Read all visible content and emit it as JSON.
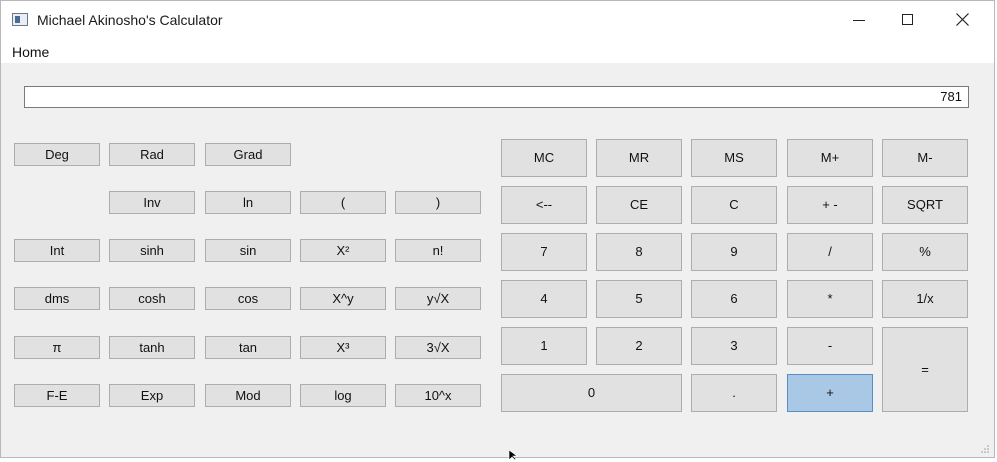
{
  "window": {
    "title": "Michael Akinosho's Calculator",
    "controls": {
      "minimize": "minimize",
      "maximize": "maximize",
      "close": "close"
    }
  },
  "menu": {
    "home": "Home"
  },
  "display": {
    "value": "781"
  },
  "scientific": {
    "deg": "Deg",
    "rad": "Rad",
    "grad": "Grad",
    "inv": "Inv",
    "ln": "ln",
    "open_paren": "(",
    "close_paren": ")",
    "int": "Int",
    "sinh": "sinh",
    "sin": "sin",
    "x_squared": "X²",
    "factorial": "n!",
    "dms": "dms",
    "cosh": "cosh",
    "cos": "cos",
    "x_pow_y": "X^y",
    "y_root_x": "y√X",
    "pi": "π",
    "tanh": "tanh",
    "tan": "tan",
    "x_cubed": "X³",
    "cube_root": "3√X",
    "fe": "F-E",
    "exp": "Exp",
    "mod": "Mod",
    "log": "log",
    "ten_pow_x": "10^x"
  },
  "keypad": {
    "mc": "MC",
    "mr": "MR",
    "ms": "MS",
    "m_plus": "M+",
    "m_minus": "M-",
    "backspace": "<--",
    "ce": "CE",
    "c": "C",
    "plus_minus": "+ -",
    "sqrt": "SQRT",
    "seven": "7",
    "eight": "8",
    "nine": "9",
    "divide": "/",
    "percent": "%",
    "four": "4",
    "five": "5",
    "six": "6",
    "multiply": "*",
    "reciprocal": "1/x",
    "one": "1",
    "two": "2",
    "three": "3",
    "minus": "-",
    "equals": "=",
    "zero": "0",
    "decimal": ".",
    "plus": "+"
  },
  "state": {
    "active_key": "+",
    "active_color": "#a9c8e6"
  }
}
